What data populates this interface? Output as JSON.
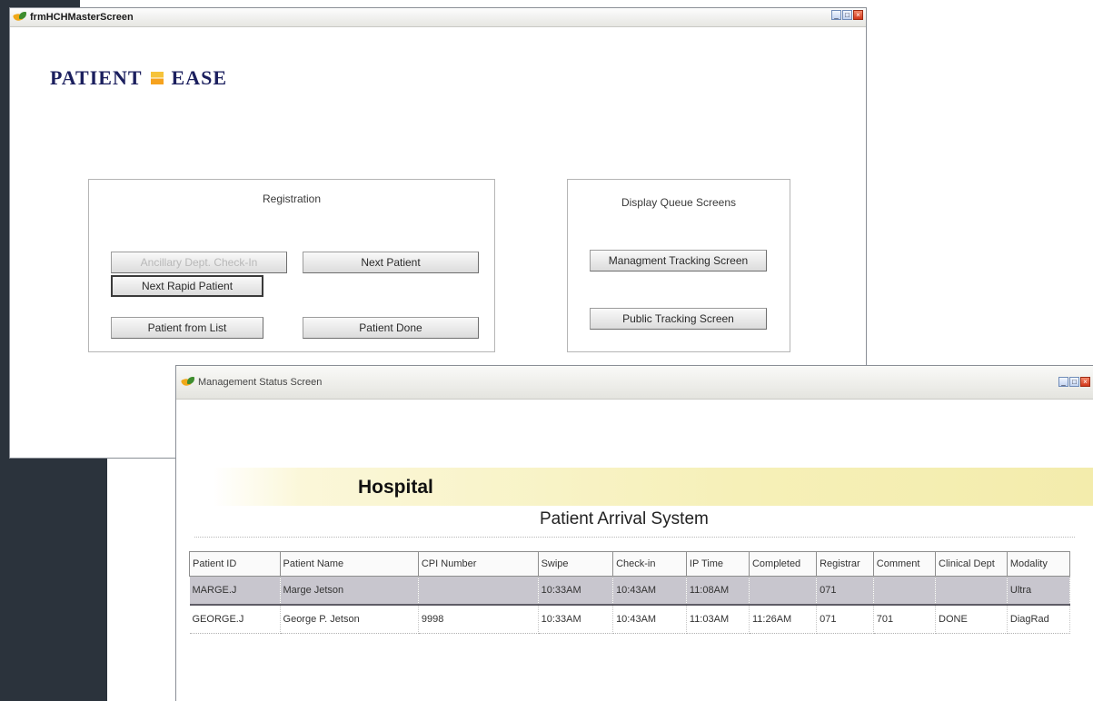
{
  "master_window": {
    "title": "frmHCHMasterScreen",
    "logo": {
      "left": "PATIENT",
      "right": "EASE"
    },
    "registration": {
      "title": "Registration",
      "buttons": {
        "ancillary": "Ancillary Dept. Check-In",
        "next_patient": "Next Patient",
        "next_rapid": "Next Rapid Patient",
        "from_list": "Patient from List",
        "done": "Patient Done"
      }
    },
    "display_queue": {
      "title": "Display Queue Screens",
      "buttons": {
        "management": "Managment Tracking Screen",
        "public": "Public Tracking Screen"
      }
    }
  },
  "status_window": {
    "title": "Management Status Screen",
    "banner_title": "Hospital",
    "system_title": "Patient Arrival System",
    "columns": [
      "Patient ID",
      "Patient Name",
      "CPI Number",
      "Swipe",
      "Check-in",
      "IP Time",
      "Completed",
      "Registrar",
      "Comment",
      "Clinical Dept",
      "Modality"
    ],
    "rows": [
      [
        "MARGE.J",
        "Marge Jetson",
        "",
        "10:33AM",
        "10:43AM",
        "11:08AM",
        "",
        "071",
        "",
        "",
        "Ultra"
      ],
      [
        "GEORGE.J",
        "George P. Jetson",
        "9998",
        "10:33AM",
        "10:43AM",
        "11:03AM",
        "11:26AM",
        "071",
        "701",
        "DONE",
        "DiagRad"
      ]
    ]
  },
  "colors": {
    "background_dark": "#2b333c",
    "logo_text": "#1b1f5e",
    "logo_mark": "#f6b02a",
    "banner": "#f6f0b8",
    "selected_row": "#c8c6ce"
  }
}
